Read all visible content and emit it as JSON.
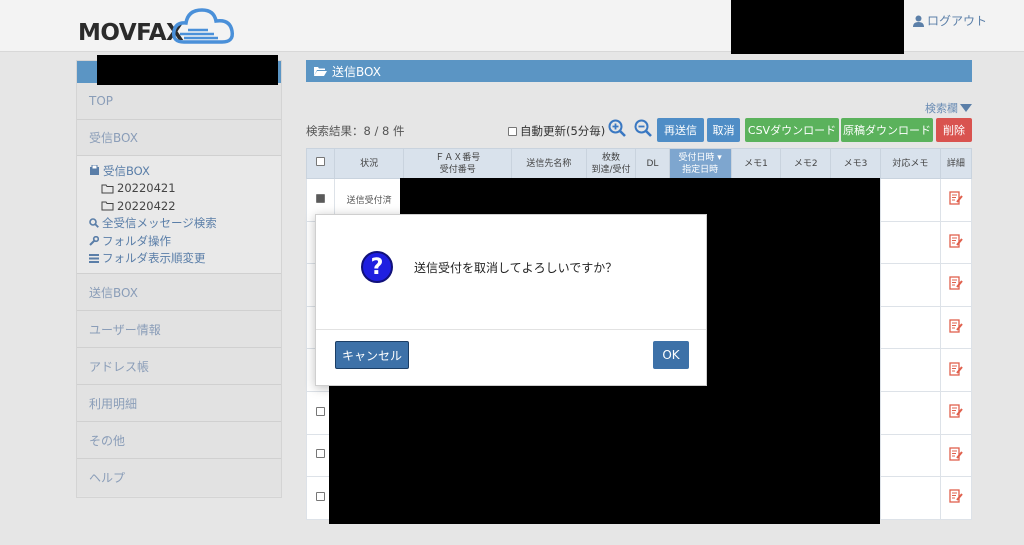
{
  "header": {
    "logo_text": "MOVFAX",
    "logout_label": "ログアウト"
  },
  "sidebar": {
    "top_label": "TOP",
    "inbox_label": "受信BOX",
    "inbox_tree": {
      "root": "受信BOX",
      "folders": [
        "20220421",
        "20220422"
      ],
      "search_all": "全受信メッセージ検索",
      "folder_ops": "フォルダ操作",
      "folder_order": "フォルダ表示順変更"
    },
    "items": [
      "送信BOX",
      "ユーザー情報",
      "アドレス帳",
      "利用明細",
      "その他",
      "ヘルプ"
    ]
  },
  "main": {
    "title": "送信BOX",
    "search_toggle": "検索欄",
    "result_text": "検索結果：8 / 8 件",
    "auto_refresh_label": "自動更新(5分毎)",
    "buttons": {
      "resend": "再送信",
      "cancel": "取消",
      "csv": "CSVダウンロード",
      "original": "原稿ダウンロード",
      "delete": "削除"
    },
    "columns": {
      "status": "状況",
      "fax_no": "ＦＡＸ番号",
      "recv_no": "受付番号",
      "dest": "送信先名称",
      "pages1": "枚数",
      "pages2": "到達/受付",
      "dl": "DL",
      "date1": "受付日時",
      "date2": "指定日時",
      "memo1": "メモ1",
      "memo2": "メモ2",
      "memo3": "メモ3",
      "resp_memo": "対応メモ",
      "detail": "詳細"
    },
    "first_row_status": "送信受付済"
  },
  "dialog": {
    "message": "送信受付を取消してよろしいですか？",
    "cancel_label": "キャンセル",
    "ok_label": "OK"
  },
  "colors": {
    "accent": "#5b95c4",
    "button_blue": "#4f8dc6",
    "button_green": "#5bb25c",
    "button_red": "#d9534f",
    "dialog_button": "#3d71a8"
  }
}
